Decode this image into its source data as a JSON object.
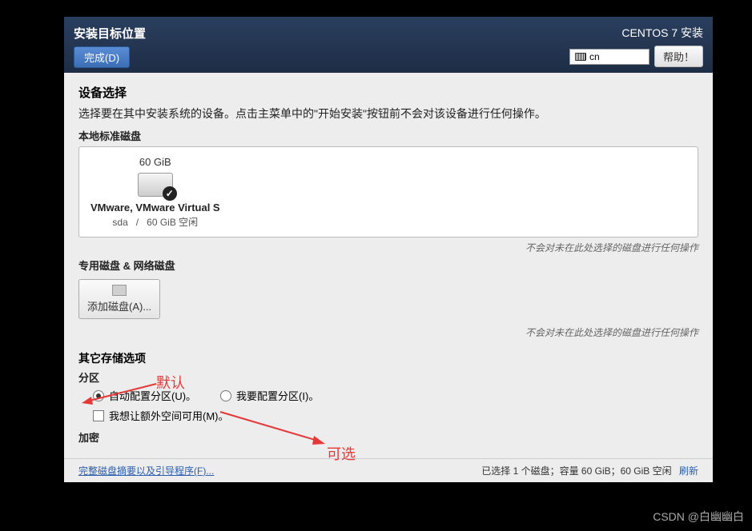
{
  "header": {
    "title": "安装目标位置",
    "done_btn": "完成(D)",
    "os_label": "CENTOS 7 安装",
    "lang": "cn",
    "help_btn": "帮助！"
  },
  "device_selection": {
    "title": "设备选择",
    "desc": "选择要在其中安装系统的设备。点击主菜单中的\"开始安装\"按钮前不会对该设备进行任何操作。",
    "local_disks_label": "本地标准磁盘",
    "disk": {
      "size": "60 GiB",
      "name": "VMware, VMware Virtual S",
      "detail_id": "sda",
      "detail_sep": "/",
      "detail_free": "60 GiB 空闲"
    },
    "hint": "不会对未在此处选择的磁盘进行任何操作"
  },
  "specialized": {
    "label": "专用磁盘 & 网络磁盘",
    "add_btn": "添加磁盘(A)...",
    "hint": "不会对未在此处选择的磁盘进行任何操作"
  },
  "storage_options": {
    "heading": "其它存储选项",
    "partition_label": "分区",
    "auto_radio": "自动配置分区(U)。",
    "manual_radio": "我要配置分区(I)。",
    "extra_space_check": "我想让额外空间可用(M)。",
    "encryption_label": "加密"
  },
  "footer": {
    "summary_link": "完整磁盘摘要以及引导程序(F)...",
    "status": "已选择 1 个磁盘；容量 60 GiB；60 GiB 空闲",
    "refresh": "刷新"
  },
  "annotations": {
    "default": "默认",
    "optional": "可选"
  },
  "watermark": "CSDN @白幽幽白"
}
